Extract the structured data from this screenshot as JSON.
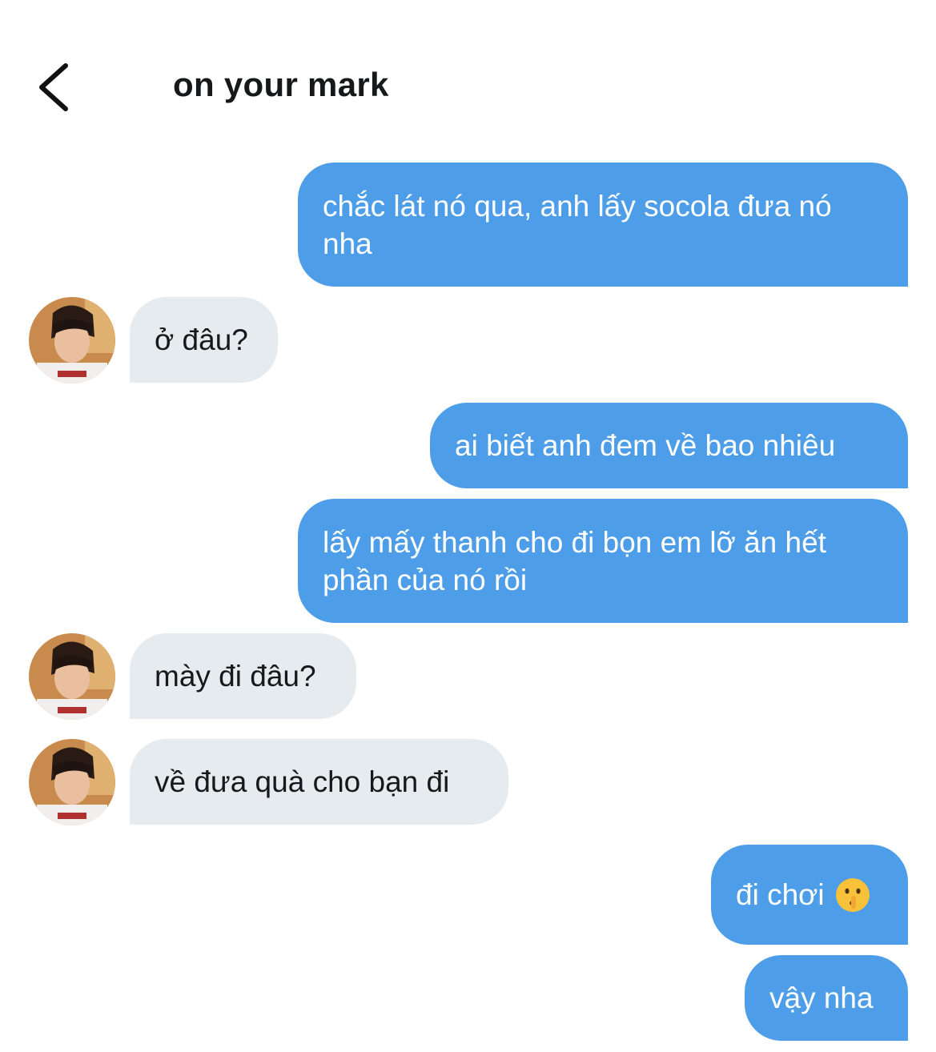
{
  "header": {
    "title": "on your mark",
    "back_icon": "chevron-left-icon"
  },
  "colors": {
    "outgoing_bubble": "#4d9de8",
    "incoming_bubble": "#e6ebef",
    "outgoing_text": "#ffffff",
    "incoming_text": "#16181a"
  },
  "messages": [
    {
      "direction": "outgoing",
      "text": "chắc lát nó qua, anh lấy socola đưa nó nha"
    },
    {
      "direction": "incoming",
      "text": "ở đâu?",
      "avatar_icon": "avatar-photo"
    },
    {
      "direction": "outgoing",
      "text": "ai biết anh đem về bao nhiêu"
    },
    {
      "direction": "outgoing",
      "text": "lấy mấy thanh cho đi bọn em lỡ ăn hết phần của nó rồi"
    },
    {
      "direction": "incoming",
      "text": "mày đi đâu?",
      "avatar_icon": "avatar-photo"
    },
    {
      "direction": "incoming",
      "text": "về đưa quà cho bạn đi",
      "avatar_icon": "avatar-photo"
    },
    {
      "direction": "outgoing",
      "text": "đi chơi",
      "emoji": "shushing-face-icon"
    },
    {
      "direction": "outgoing",
      "text": "vậy nha"
    }
  ]
}
